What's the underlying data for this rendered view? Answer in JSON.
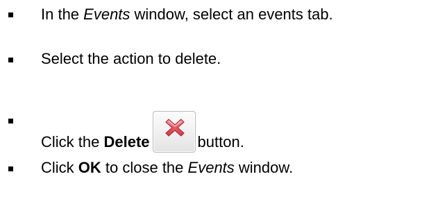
{
  "instructions": {
    "step1": {
      "before": "In the ",
      "emphasis": "Events",
      "after": " window, select an events tab."
    },
    "step2": {
      "text": "Select the action to delete."
    },
    "step3": {
      "before": "Click the ",
      "bold": "Delete",
      "after": "button.",
      "icon": "delete-x-icon"
    },
    "step4": {
      "before": "Click ",
      "bold": "OK",
      "middle": " to close the ",
      "emphasis": "Events",
      "after": " window."
    }
  },
  "colors": {
    "text": "#000000",
    "icon_red": "#e04a55",
    "button_border": "#b9b9b9"
  }
}
